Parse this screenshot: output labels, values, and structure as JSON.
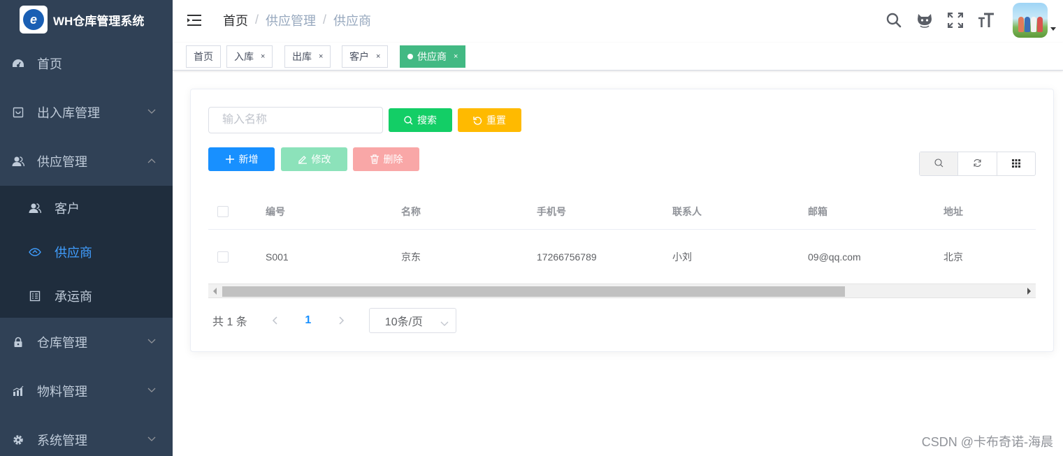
{
  "sidebar": {
    "logo_text": "WH仓库管理系统",
    "logo_mark": "e",
    "items": [
      {
        "label": "首页",
        "icon": "dashboard-icon"
      },
      {
        "label": "出入库管理",
        "icon": "inbox-icon"
      },
      {
        "label": "供应管理",
        "icon": "peoples-icon",
        "expanded": true
      },
      {
        "label": "仓库管理",
        "icon": "lock-icon"
      },
      {
        "label": "物料管理",
        "icon": "chart-icon"
      },
      {
        "label": "系统管理",
        "icon": "gear-icon"
      }
    ],
    "subitems": [
      {
        "label": "客户",
        "icon": "user-icon"
      },
      {
        "label": "供应商",
        "icon": "eye-icon",
        "active": true
      },
      {
        "label": "承运商",
        "icon": "document-icon"
      }
    ]
  },
  "navbar": {
    "breadcrumb": [
      "首页",
      "供应管理",
      "供应商"
    ],
    "separator": "/"
  },
  "tags": [
    {
      "label": "首页"
    },
    {
      "label": "入库",
      "close": "×"
    },
    {
      "label": "出库",
      "close": "×"
    },
    {
      "label": "客户",
      "close": "×"
    },
    {
      "label": "供应商",
      "close": "×",
      "active": true
    }
  ],
  "search": {
    "placeholder": "输入名称",
    "value": "",
    "search_label": "搜索",
    "reset_label": "重置"
  },
  "toolbar": {
    "add_label": "新增",
    "edit_label": "修改",
    "delete_label": "删除"
  },
  "table": {
    "columns": [
      "编号",
      "名称",
      "手机号",
      "联系人",
      "邮箱",
      "地址"
    ],
    "rows": [
      [
        "S001",
        "京东",
        "17266756789",
        "小刘",
        "09@qq.com",
        "北京"
      ]
    ]
  },
  "pagination": {
    "total_text": "共 1 条",
    "current_page": "1",
    "page_size": "10条/页"
  },
  "watermark": "CSDN @卡布奇诺-海晨",
  "colors": {
    "sidebar_bg": "#304156",
    "submenu_bg": "#1f2d3d",
    "active_blue": "#409eff",
    "tag_active": "#42b983",
    "search_btn": "#13ce66",
    "reset_btn": "#ffba00",
    "add_btn": "#1890ff",
    "edit_btn": "#8ce2ba",
    "delete_btn": "#f9a7a7"
  }
}
